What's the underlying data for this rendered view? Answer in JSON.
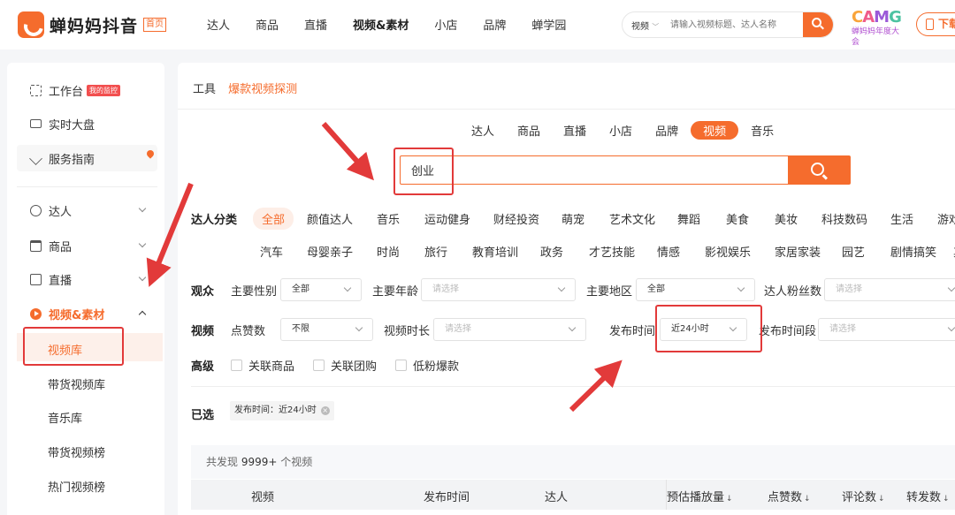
{
  "header": {
    "logo_text": "蝉妈妈抖音",
    "logo_badge": "首页",
    "nav": [
      "达人",
      "商品",
      "直播",
      "视频&素材",
      "小店",
      "品牌",
      "蝉学园"
    ],
    "search_type": "视频",
    "search_placeholder": "请输入视频标题、达人名称",
    "camg_letters": "CAMG",
    "camg_sub": "蝉妈妈年度大会",
    "download_label": "下载"
  },
  "sidebar": {
    "workbench": "工作台",
    "workbench_tag": "我的监控",
    "realtime": "实时大盘",
    "guide": "服务指南",
    "daren": "达人",
    "goods": "商品",
    "live": "直播",
    "video_material": "视频&素材",
    "sub_items": [
      "视频库",
      "带货视频库",
      "音乐库",
      "带货视频榜",
      "热门视频榜"
    ]
  },
  "main": {
    "crumb_root": "工具",
    "crumb_current": "爆款视频探测",
    "cat_tabs": [
      "达人",
      "商品",
      "直播",
      "小店",
      "品牌",
      "视频",
      "音乐"
    ],
    "search_value": "创业",
    "daren_category_label": "达人分类",
    "categories_row1": [
      "全部",
      "颜值达人",
      "音乐",
      "运动健身",
      "财经投资",
      "萌宠",
      "艺术文化",
      "舞蹈",
      "美食",
      "美妆",
      "科技数码",
      "生活",
      "游戏"
    ],
    "categories_row2": [
      "汽车",
      "母婴亲子",
      "时尚",
      "旅行",
      "教育培训",
      "政务",
      "才艺技能",
      "情感",
      "影视娱乐",
      "家居家装",
      "园艺",
      "剧情搞笑",
      "其他"
    ],
    "audience": {
      "label": "观众",
      "gender_label": "主要性别",
      "gender_value": "全部",
      "age_label": "主要年龄",
      "age_placeholder": "请选择",
      "region_label": "主要地区",
      "region_value": "全部",
      "fans_label": "达人粉丝数",
      "fans_placeholder": "请选择"
    },
    "video": {
      "label": "视频",
      "likes_label": "点赞数",
      "likes_value": "不限",
      "duration_label": "视频时长",
      "duration_placeholder": "请选择",
      "publish_label": "发布时间",
      "publish_value": "近24小时",
      "period_label": "发布时间段",
      "period_placeholder": "请选择"
    },
    "advanced": {
      "label": "高级",
      "options": [
        "关联商品",
        "关联团购",
        "低粉爆款"
      ]
    },
    "selected": {
      "label": "已选",
      "tag": "发布时间：近24小时",
      "remove": "×"
    },
    "results": {
      "prefix": "共发现",
      "count": "9999+",
      "suffix": "个视频"
    },
    "columns": [
      "视频",
      "发布时间",
      "达人",
      "预估播放量",
      "点赞数",
      "评论数",
      "转发数"
    ],
    "sort_glyph": "↓"
  },
  "colors": {
    "accent": "#f56c2d",
    "annotation": "#e23a3a"
  }
}
